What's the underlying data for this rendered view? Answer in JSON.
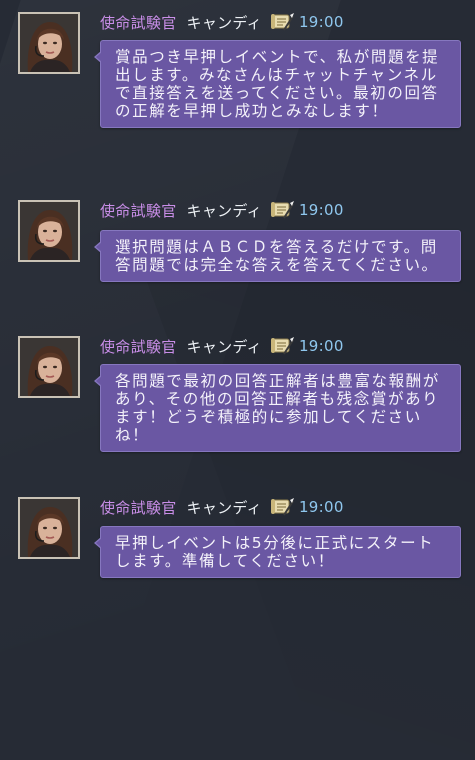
{
  "messages": [
    {
      "title": "使命試験官",
      "name": "キャンディ",
      "badge_icon": "scroll-quill-icon",
      "time": "19:00",
      "text": "賞品つき早押しイベントで、私が問題を提出します。みなさんはチャットチャンネルで直接答えを送ってください。最初の回答の正解を早押し成功とみなします！"
    },
    {
      "title": "使命試験官",
      "name": "キャンディ",
      "badge_icon": "scroll-quill-icon",
      "time": "19:00",
      "text": "選択問題はＡＢＣＤを答えるだけです。問答問題では完全な答えを答えてください。"
    },
    {
      "title": "使命試験官",
      "name": "キャンディ",
      "badge_icon": "scroll-quill-icon",
      "time": "19:00",
      "text": "各問題で最初の回答正解者は豊富な報酬があり、その他の回答正解者も残念賞があります！どうぞ積極的に参加してくださいね！"
    },
    {
      "title": "使命試験官",
      "name": "キャンディ",
      "badge_icon": "scroll-quill-icon",
      "time": "19:00",
      "text": "早押しイベントは5分後に正式にスタートします。準備してください！"
    }
  ],
  "colors": {
    "background": "#262b35",
    "bubble": "#6a57a3",
    "title": "#c98ee8",
    "time": "#8fc7ee"
  }
}
